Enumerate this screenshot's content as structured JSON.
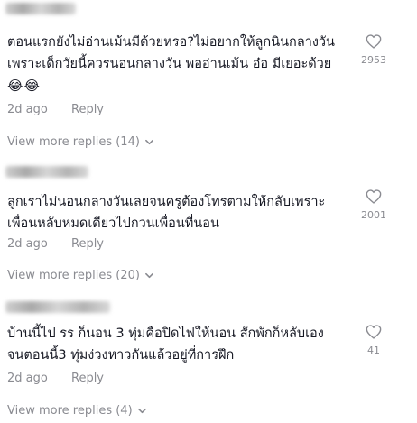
{
  "comments": [
    {
      "text_line1": "ตอนแรกยังไม่อ่านเม้นมีด้วยหรอ?ไม่อยากให้ลูกนินกลางวัน",
      "text_line2": "เพราะเด็กวัยนี้ควรนอนกลางวัน พออ่านเม้น อ๋อ มีเยอะด้วย",
      "emoji": "😂😂",
      "date": "2d ago",
      "reply_label": "Reply",
      "view_more": "View more replies (14)",
      "like_count": "2953"
    },
    {
      "text_line1": "ลูกเราไม่นอนกลางวันเลยจนครูต้องโทรตามให้กลับเพราะ",
      "text_line2": "เพื่อนหลับหมดเดียวไปกวนเพื่อนที่นอน",
      "date": "2d ago",
      "reply_label": "Reply",
      "view_more": "View more replies (20)",
      "like_count": "2001"
    },
    {
      "text_line1": "บ้านนี้ไป รร ก็นอน 3 ทุ่มคือปิดไฟให้นอน สักพักก็หลับเอง",
      "text_line2": "จนตอนนี้3 ทุ่มง่วงหาวกันแล้วอยู่ที่การฝึก",
      "date": "2d ago",
      "reply_label": "Reply",
      "view_more": "View more replies (4)",
      "like_count": "41"
    }
  ]
}
